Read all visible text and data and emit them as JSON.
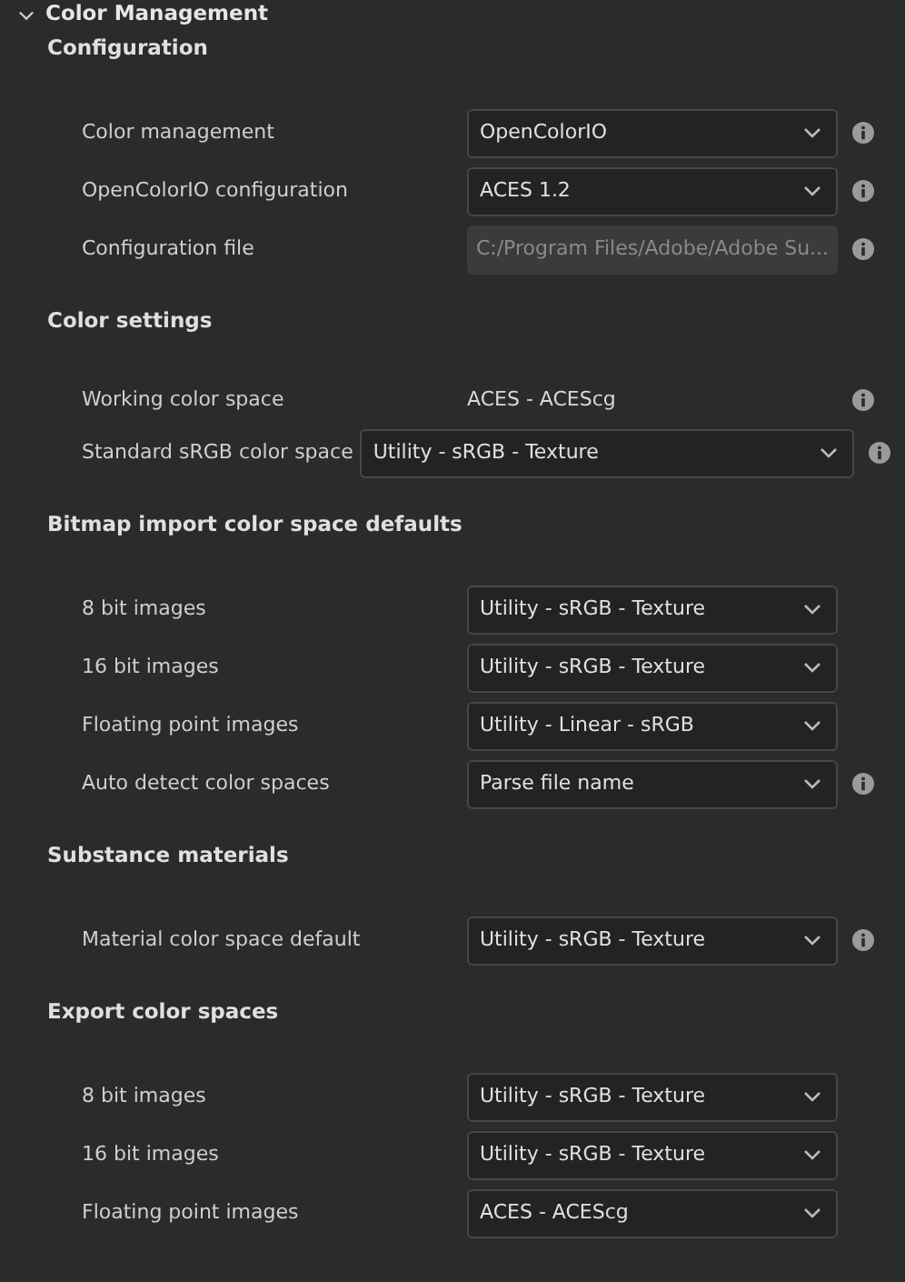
{
  "panel": {
    "title": "Color Management",
    "expanded": true
  },
  "sections": [
    {
      "title": "Configuration",
      "rows": [
        {
          "kind": "dropdown",
          "label": "Color management",
          "value": "OpenColorIO",
          "info": true
        },
        {
          "kind": "dropdown",
          "label": "OpenColorIO configuration",
          "value": "ACES 1.2",
          "info": true
        },
        {
          "kind": "path",
          "label": "Configuration file",
          "value": "C:/Program Files/Adobe/Adobe Su...",
          "info": true
        }
      ]
    },
    {
      "title": "Color settings",
      "rows": [
        {
          "kind": "text",
          "label": "Working color space",
          "value": "ACES - ACEScg",
          "info": true
        },
        {
          "kind": "wide-dropdown",
          "label": "Standard sRGB color space",
          "value": "Utility - sRGB - Texture",
          "info": true
        }
      ]
    },
    {
      "title": "Bitmap import color space defaults",
      "rows": [
        {
          "kind": "dropdown",
          "label": "8 bit images",
          "value": "Utility - sRGB - Texture",
          "info": false
        },
        {
          "kind": "dropdown",
          "label": "16 bit images",
          "value": "Utility - sRGB - Texture",
          "info": false
        },
        {
          "kind": "dropdown",
          "label": "Floating point images",
          "value": "Utility - Linear - sRGB",
          "info": false
        },
        {
          "kind": "dropdown",
          "label": "Auto detect color spaces",
          "value": "Parse file name",
          "info": true
        }
      ]
    },
    {
      "title": "Substance materials",
      "rows": [
        {
          "kind": "dropdown",
          "label": "Material color space default",
          "value": "Utility - sRGB - Texture",
          "info": true
        }
      ]
    },
    {
      "title": "Export color spaces",
      "rows": [
        {
          "kind": "dropdown",
          "label": "8 bit images",
          "value": "Utility - sRGB - Texture",
          "info": false
        },
        {
          "kind": "dropdown",
          "label": "16 bit images",
          "value": "Utility - sRGB - Texture",
          "info": false
        },
        {
          "kind": "dropdown",
          "label": "Floating point images",
          "value": "ACES - ACEScg",
          "info": false
        }
      ]
    }
  ]
}
